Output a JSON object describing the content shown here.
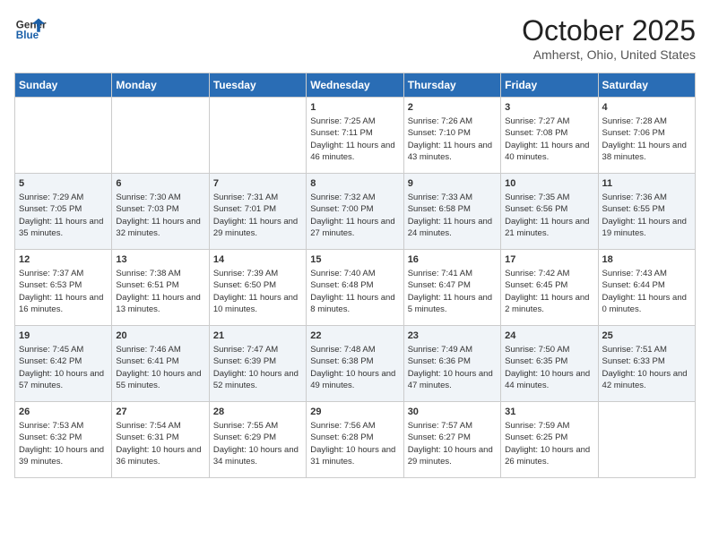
{
  "header": {
    "logo_line1": "General",
    "logo_line2": "Blue",
    "month": "October 2025",
    "location": "Amherst, Ohio, United States"
  },
  "days_of_week": [
    "Sunday",
    "Monday",
    "Tuesday",
    "Wednesday",
    "Thursday",
    "Friday",
    "Saturday"
  ],
  "weeks": [
    [
      {
        "num": "",
        "info": ""
      },
      {
        "num": "",
        "info": ""
      },
      {
        "num": "",
        "info": ""
      },
      {
        "num": "1",
        "info": "Sunrise: 7:25 AM\nSunset: 7:11 PM\nDaylight: 11 hours and 46 minutes."
      },
      {
        "num": "2",
        "info": "Sunrise: 7:26 AM\nSunset: 7:10 PM\nDaylight: 11 hours and 43 minutes."
      },
      {
        "num": "3",
        "info": "Sunrise: 7:27 AM\nSunset: 7:08 PM\nDaylight: 11 hours and 40 minutes."
      },
      {
        "num": "4",
        "info": "Sunrise: 7:28 AM\nSunset: 7:06 PM\nDaylight: 11 hours and 38 minutes."
      }
    ],
    [
      {
        "num": "5",
        "info": "Sunrise: 7:29 AM\nSunset: 7:05 PM\nDaylight: 11 hours and 35 minutes."
      },
      {
        "num": "6",
        "info": "Sunrise: 7:30 AM\nSunset: 7:03 PM\nDaylight: 11 hours and 32 minutes."
      },
      {
        "num": "7",
        "info": "Sunrise: 7:31 AM\nSunset: 7:01 PM\nDaylight: 11 hours and 29 minutes."
      },
      {
        "num": "8",
        "info": "Sunrise: 7:32 AM\nSunset: 7:00 PM\nDaylight: 11 hours and 27 minutes."
      },
      {
        "num": "9",
        "info": "Sunrise: 7:33 AM\nSunset: 6:58 PM\nDaylight: 11 hours and 24 minutes."
      },
      {
        "num": "10",
        "info": "Sunrise: 7:35 AM\nSunset: 6:56 PM\nDaylight: 11 hours and 21 minutes."
      },
      {
        "num": "11",
        "info": "Sunrise: 7:36 AM\nSunset: 6:55 PM\nDaylight: 11 hours and 19 minutes."
      }
    ],
    [
      {
        "num": "12",
        "info": "Sunrise: 7:37 AM\nSunset: 6:53 PM\nDaylight: 11 hours and 16 minutes."
      },
      {
        "num": "13",
        "info": "Sunrise: 7:38 AM\nSunset: 6:51 PM\nDaylight: 11 hours and 13 minutes."
      },
      {
        "num": "14",
        "info": "Sunrise: 7:39 AM\nSunset: 6:50 PM\nDaylight: 11 hours and 10 minutes."
      },
      {
        "num": "15",
        "info": "Sunrise: 7:40 AM\nSunset: 6:48 PM\nDaylight: 11 hours and 8 minutes."
      },
      {
        "num": "16",
        "info": "Sunrise: 7:41 AM\nSunset: 6:47 PM\nDaylight: 11 hours and 5 minutes."
      },
      {
        "num": "17",
        "info": "Sunrise: 7:42 AM\nSunset: 6:45 PM\nDaylight: 11 hours and 2 minutes."
      },
      {
        "num": "18",
        "info": "Sunrise: 7:43 AM\nSunset: 6:44 PM\nDaylight: 11 hours and 0 minutes."
      }
    ],
    [
      {
        "num": "19",
        "info": "Sunrise: 7:45 AM\nSunset: 6:42 PM\nDaylight: 10 hours and 57 minutes."
      },
      {
        "num": "20",
        "info": "Sunrise: 7:46 AM\nSunset: 6:41 PM\nDaylight: 10 hours and 55 minutes."
      },
      {
        "num": "21",
        "info": "Sunrise: 7:47 AM\nSunset: 6:39 PM\nDaylight: 10 hours and 52 minutes."
      },
      {
        "num": "22",
        "info": "Sunrise: 7:48 AM\nSunset: 6:38 PM\nDaylight: 10 hours and 49 minutes."
      },
      {
        "num": "23",
        "info": "Sunrise: 7:49 AM\nSunset: 6:36 PM\nDaylight: 10 hours and 47 minutes."
      },
      {
        "num": "24",
        "info": "Sunrise: 7:50 AM\nSunset: 6:35 PM\nDaylight: 10 hours and 44 minutes."
      },
      {
        "num": "25",
        "info": "Sunrise: 7:51 AM\nSunset: 6:33 PM\nDaylight: 10 hours and 42 minutes."
      }
    ],
    [
      {
        "num": "26",
        "info": "Sunrise: 7:53 AM\nSunset: 6:32 PM\nDaylight: 10 hours and 39 minutes."
      },
      {
        "num": "27",
        "info": "Sunrise: 7:54 AM\nSunset: 6:31 PM\nDaylight: 10 hours and 36 minutes."
      },
      {
        "num": "28",
        "info": "Sunrise: 7:55 AM\nSunset: 6:29 PM\nDaylight: 10 hours and 34 minutes."
      },
      {
        "num": "29",
        "info": "Sunrise: 7:56 AM\nSunset: 6:28 PM\nDaylight: 10 hours and 31 minutes."
      },
      {
        "num": "30",
        "info": "Sunrise: 7:57 AM\nSunset: 6:27 PM\nDaylight: 10 hours and 29 minutes."
      },
      {
        "num": "31",
        "info": "Sunrise: 7:59 AM\nSunset: 6:25 PM\nDaylight: 10 hours and 26 minutes."
      },
      {
        "num": "",
        "info": ""
      }
    ]
  ]
}
